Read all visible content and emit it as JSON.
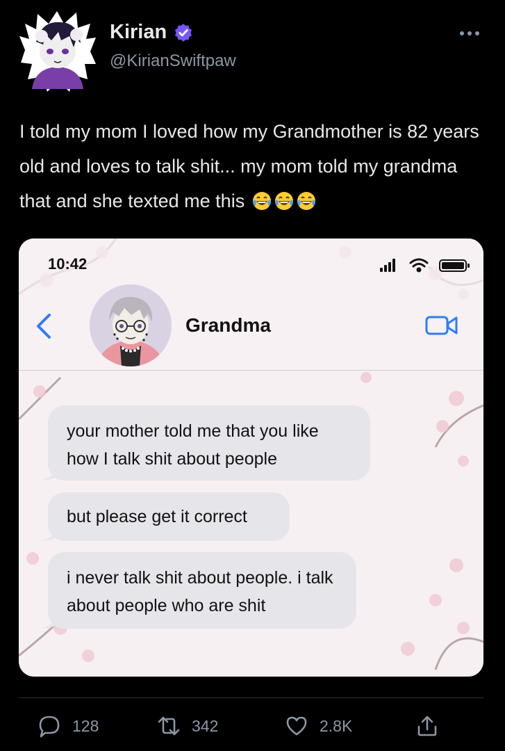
{
  "author": {
    "display_name": "Kirian",
    "handle": "@KirianSwiftpaw",
    "verified_color": "#7856ff"
  },
  "tweet": {
    "text": "I told my mom I loved how my Grandmother is 82 years old and loves to talk shit... my mom told my grandma that and she texted me this",
    "emoji": [
      "face-with-tears-of-joy",
      "face-with-tears-of-joy",
      "face-with-tears-of-joy"
    ]
  },
  "screenshot": {
    "status_time": "10:42",
    "contact_name": "Grandma",
    "accent": "#2f7cf6",
    "messages": [
      {
        "text": "your mother told me that you like how I talk shit about people"
      },
      {
        "text": "but please get it correct"
      },
      {
        "text": "i never talk shit about people. i talk about people who are shit"
      }
    ]
  },
  "actions": {
    "replies": "128",
    "retweets": "342",
    "likes": "2.8K"
  },
  "icons": {
    "more": "more-icon",
    "reply": "reply-icon",
    "retweet": "retweet-icon",
    "like": "heart-icon",
    "share": "share-icon"
  }
}
